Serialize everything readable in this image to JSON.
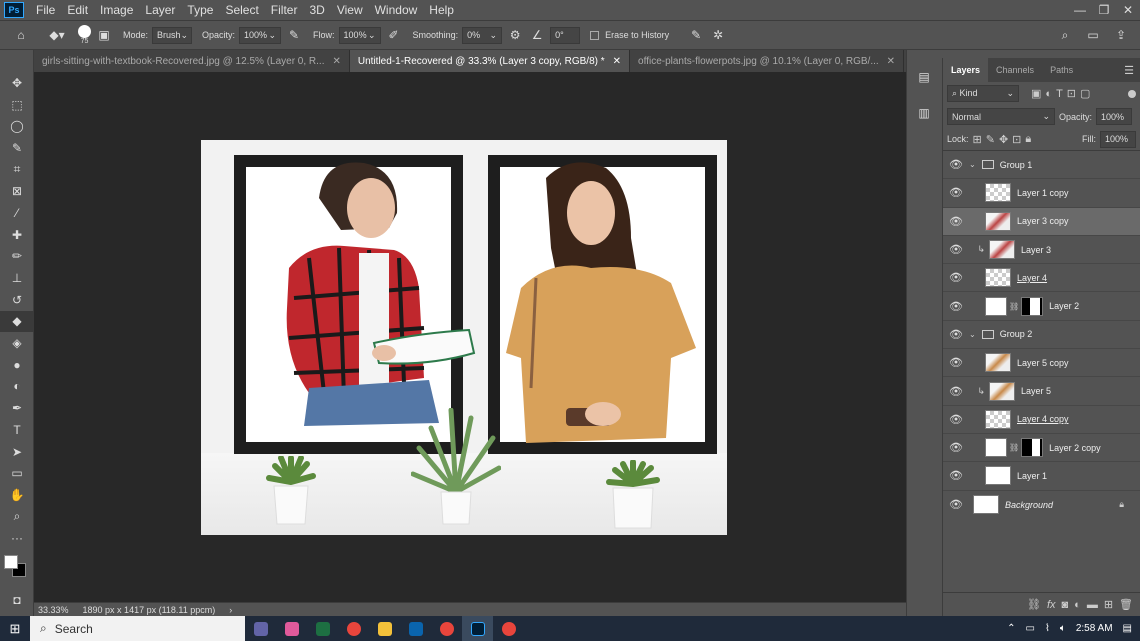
{
  "menubar": {
    "logo": "Ps",
    "items": [
      "File",
      "Edit",
      "Image",
      "Layer",
      "Type",
      "Select",
      "Filter",
      "3D",
      "View",
      "Window",
      "Help"
    ]
  },
  "options": {
    "brush_size": "75",
    "mode_label": "Mode:",
    "mode_value": "Brush",
    "opacity_label": "Opacity:",
    "opacity_value": "100%",
    "flow_label": "Flow:",
    "flow_value": "100%",
    "smoothing_label": "Smoothing:",
    "smoothing_value": "0%",
    "angle_value": "0°",
    "erase_history_label": "Erase to History"
  },
  "tabs": [
    {
      "label": "girls-sitting-with-textbook-Recovered.jpg @ 12.5% (Layer 0, R...",
      "active": false
    },
    {
      "label": "Untitled-1-Recovered @ 33.3% (Layer 3 copy, RGB/8) *",
      "active": true
    },
    {
      "label": "office-plants-flowerpots.jpg @ 10.1% (Layer 0, RGB/...",
      "active": false
    }
  ],
  "status": {
    "zoom": "33.33%",
    "doc_info": "1890 px x 1417 px (118.11 ppcm)"
  },
  "layers_panel": {
    "tabs": [
      "Layers",
      "Channels",
      "Paths"
    ],
    "kind_label": "Kind",
    "blend_mode": "Normal",
    "opacity_label": "Opacity:",
    "opacity_value": "100%",
    "lock_label": "Lock:",
    "fill_label": "Fill:",
    "fill_value": "100%",
    "layers": [
      {
        "name": "Group 1",
        "type": "group"
      },
      {
        "name": "Layer 1 copy",
        "type": "layer"
      },
      {
        "name": "Layer 3 copy",
        "type": "layer",
        "selected": true
      },
      {
        "name": "Layer 3",
        "type": "clipped"
      },
      {
        "name": "Layer 4",
        "type": "layer"
      },
      {
        "name": "Layer 2",
        "type": "masked"
      },
      {
        "name": "Group 2",
        "type": "group"
      },
      {
        "name": "Layer 5 copy",
        "type": "layer"
      },
      {
        "name": "Layer 5",
        "type": "clipped"
      },
      {
        "name": "Layer 4 copy",
        "type": "layer"
      },
      {
        "name": "Layer 2 copy",
        "type": "masked"
      },
      {
        "name": "Layer 1",
        "type": "layer"
      },
      {
        "name": "Background",
        "type": "background"
      }
    ]
  },
  "taskbar": {
    "search_placeholder": "Search",
    "time": "2:58 AM"
  }
}
